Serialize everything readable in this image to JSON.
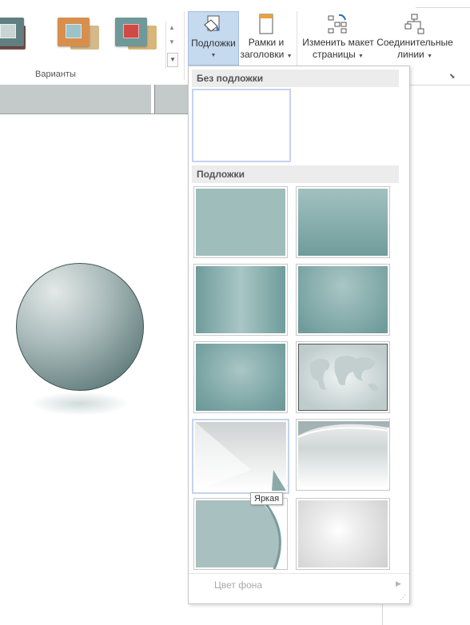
{
  "ribbon": {
    "variants_group_label": "Варианты",
    "backgrounds_button": {
      "line1": "Подложки",
      "icon": "backgrounds-icon"
    },
    "borders_button": {
      "line1": "Рамки и",
      "line2": "заголовки",
      "icon": "borders-titles-icon"
    },
    "relayout_button": {
      "line1": "Изменить макет",
      "line2": "страницы",
      "icon": "relayout-icon"
    },
    "connectors_button": {
      "line1": "Соединительные",
      "line2": "линии",
      "icon": "connectors-icon"
    },
    "variants": [
      {
        "name": "variant-gray",
        "back": "#7a4a4a",
        "front": "#5f7f80",
        "front2": "#c9d4d4"
      },
      {
        "name": "variant-orange",
        "back": "#d4b98a",
        "front": "#d88f4e",
        "front2": "#9dc3c9"
      },
      {
        "name": "variant-red",
        "back": "#d8b67a",
        "front": "#6f9898",
        "front2": "#cf4a45"
      }
    ]
  },
  "dropdown": {
    "section_no_background": "Без подложки",
    "section_backgrounds": "Подложки",
    "background_color_label": "Цвет фона",
    "tooltip": "Яркая"
  },
  "colors": {
    "accent_highlight": "#c5d9ef",
    "teal_dark": "#6e9b9b",
    "teal_light": "#a6c2c2"
  }
}
